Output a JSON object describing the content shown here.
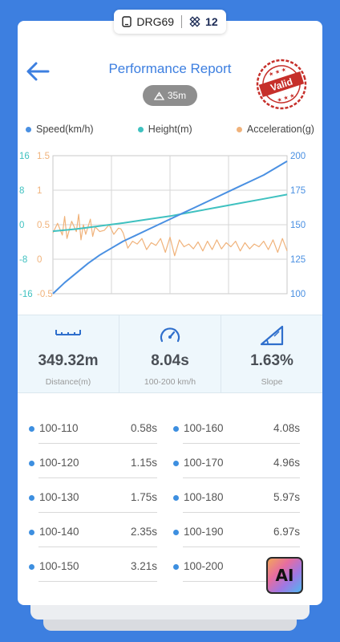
{
  "device": {
    "name": "DRG69",
    "satellite_count": "12"
  },
  "header": {
    "title": "Performance Report",
    "stamp_text": "Valid"
  },
  "height_badge": "35m",
  "legend": [
    {
      "label": "Speed(km/h)",
      "color": "#4a90e2"
    },
    {
      "label": "Height(m)",
      "color": "#3fc1c0"
    },
    {
      "label": "Acceleration(g)",
      "color": "#f0b27a"
    }
  ],
  "chart_data": {
    "type": "line",
    "left_axis_height": {
      "ticks": [
        "16",
        "8",
        "0",
        "-8",
        "-16"
      ],
      "range": [
        -16,
        16
      ],
      "color": "#3fc1c0"
    },
    "left_axis_acceleration": {
      "ticks": [
        "1.5",
        "1",
        "0.5",
        "0",
        "-0.5"
      ],
      "range": [
        -0.5,
        1.5
      ],
      "color": "#f0b27a"
    },
    "right_axis_speed": {
      "ticks": [
        "200",
        "175",
        "150",
        "125",
        "100"
      ],
      "range": [
        100,
        200
      ],
      "color": "#4a90e2"
    },
    "x_range": [
      0,
      100
    ],
    "grid": true,
    "series": [
      {
        "name": "Speed(km/h)",
        "axis": "speed",
        "color": "#4a90e2",
        "x": [
          0,
          5,
          10,
          15,
          20,
          25,
          30,
          35,
          40,
          45,
          50,
          55,
          60,
          65,
          70,
          75,
          80,
          85,
          90,
          95,
          100
        ],
        "values": [
          100,
          108,
          115,
          122,
          128,
          133,
          138,
          142,
          146,
          150,
          154,
          158,
          162,
          166,
          170,
          174,
          178,
          182,
          186,
          191,
          196
        ]
      },
      {
        "name": "Height(m)",
        "axis": "height",
        "color": "#3fc1c0",
        "x": [
          0,
          10,
          20,
          30,
          40,
          50,
          60,
          70,
          80,
          90,
          100
        ],
        "values": [
          -1.5,
          -1.0,
          -0.3,
          0.4,
          1.2,
          2.0,
          3.0,
          4.0,
          5.0,
          6.0,
          7.0
        ]
      },
      {
        "name": "Acceleration(g)",
        "axis": "acceleration",
        "color": "#f0b27a",
        "x": [
          0,
          2,
          4,
          5,
          6,
          8,
          10,
          11,
          12,
          13,
          14,
          16,
          17,
          18,
          20,
          22,
          24,
          26,
          28,
          29,
          30,
          32,
          34,
          36,
          38,
          40,
          42,
          44,
          46,
          48,
          50,
          52,
          54,
          56,
          58,
          60,
          62,
          64,
          66,
          68,
          70,
          72,
          74,
          76,
          78,
          80,
          82,
          84,
          86,
          88,
          90,
          92,
          94,
          96,
          98,
          100
        ],
        "values": [
          0.38,
          0.52,
          0.35,
          0.62,
          0.3,
          0.55,
          0.4,
          0.65,
          0.28,
          0.5,
          0.36,
          0.58,
          0.33,
          0.47,
          0.4,
          0.42,
          0.5,
          0.36,
          0.45,
          0.44,
          0.38,
          0.16,
          0.26,
          0.22,
          0.3,
          0.14,
          0.24,
          0.2,
          0.3,
          0.1,
          0.32,
          0.05,
          0.28,
          0.18,
          0.22,
          0.15,
          0.25,
          0.12,
          0.26,
          0.14,
          0.28,
          0.15,
          0.24,
          0.18,
          0.26,
          0.12,
          0.24,
          0.15,
          0.22,
          0.18,
          0.26,
          0.14,
          0.28,
          0.1,
          0.3,
          0.12
        ]
      }
    ]
  },
  "stats": [
    {
      "value": "349.32m",
      "label": "Distance(m)",
      "icon": "ruler-icon"
    },
    {
      "value": "8.04s",
      "label": "100-200 km/h",
      "icon": "speedometer-icon"
    },
    {
      "value": "1.63%",
      "label": "Slope",
      "icon": "slope-icon"
    }
  ],
  "times_left": [
    {
      "range": "100-110",
      "time": "0.58s"
    },
    {
      "range": "100-120",
      "time": "1.15s"
    },
    {
      "range": "100-130",
      "time": "1.75s"
    },
    {
      "range": "100-140",
      "time": "2.35s"
    },
    {
      "range": "100-150",
      "time": "3.21s"
    }
  ],
  "times_right": [
    {
      "range": "100-160",
      "time": "4.08s"
    },
    {
      "range": "100-170",
      "time": "4.96s"
    },
    {
      "range": "100-180",
      "time": "5.97s"
    },
    {
      "range": "100-190",
      "time": "6.97s"
    },
    {
      "range": "100-200",
      "time": ""
    }
  ],
  "ai_button": "AI"
}
